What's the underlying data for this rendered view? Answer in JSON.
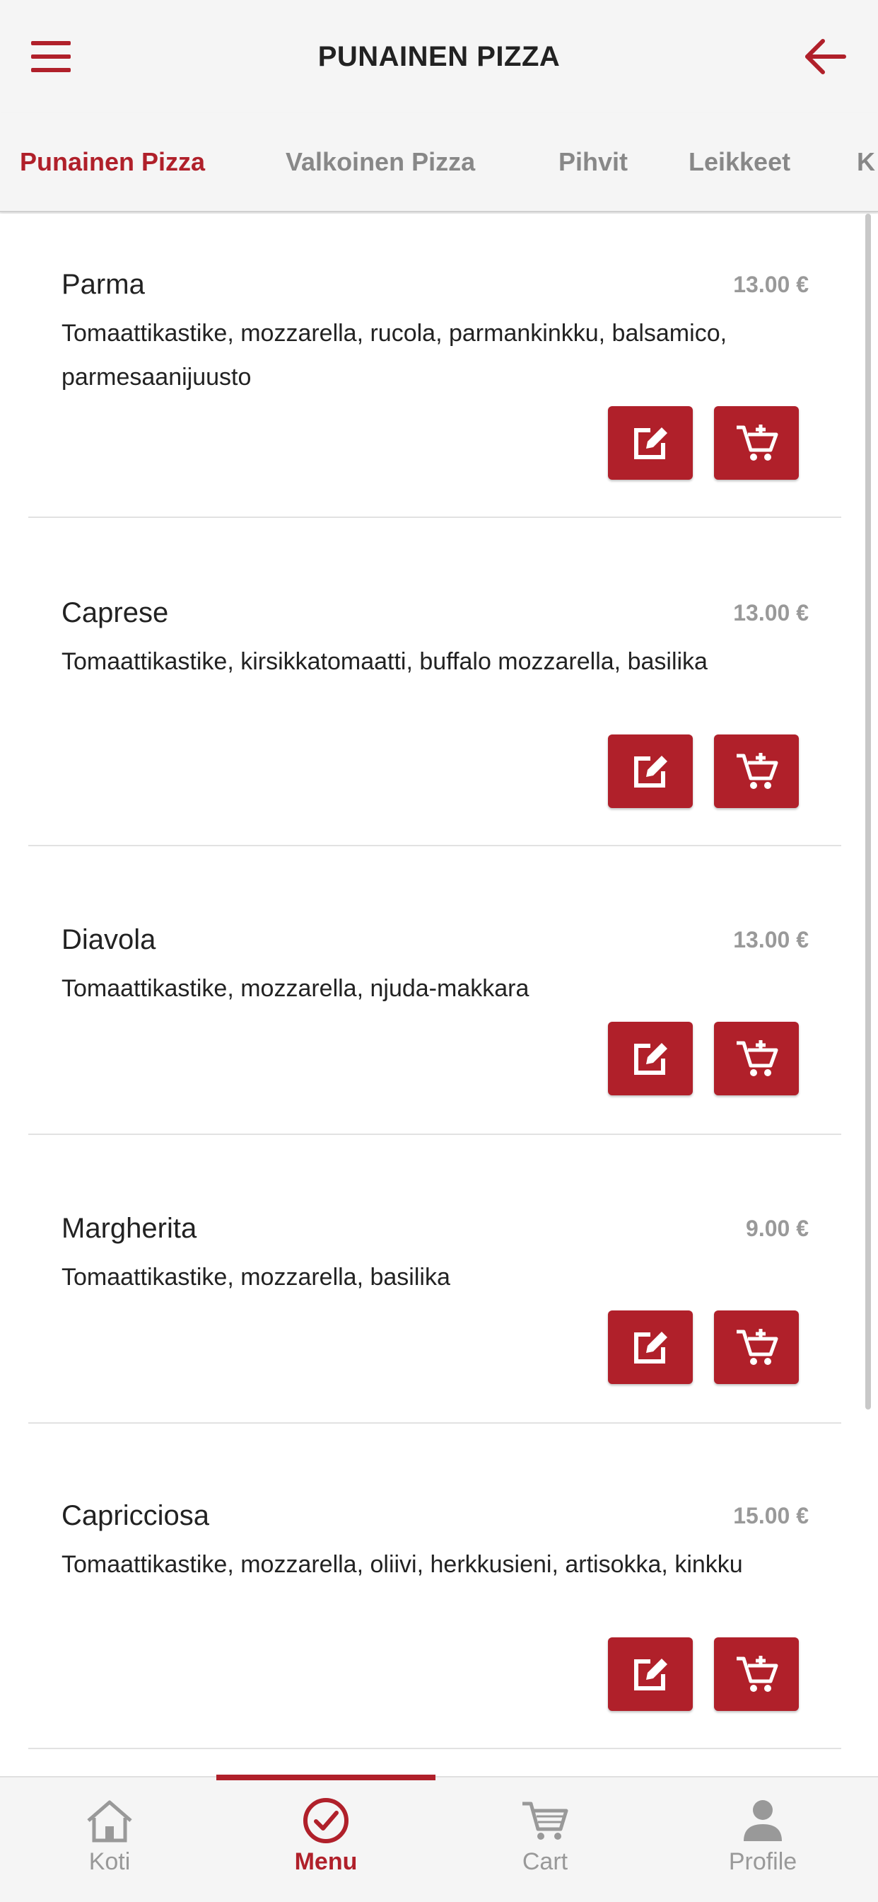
{
  "header": {
    "title": "PUNAINEN PIZZA"
  },
  "tabs": [
    {
      "label": "Punainen Pizza",
      "active": true
    },
    {
      "label": "Valkoinen Pizza",
      "active": false
    },
    {
      "label": "Pihvit",
      "active": false
    },
    {
      "label": "Leikkeet",
      "active": false
    },
    {
      "label": "K",
      "active": false
    }
  ],
  "items": [
    {
      "name": "Parma",
      "price": "13.00 €",
      "description": "Tomaattikastike, mozzarella, rucola, parmankinkku, balsamico, parmesaanijuusto"
    },
    {
      "name": "Caprese",
      "price": "13.00 €",
      "description": "Tomaattikastike, kirsikkatomaatti, buffalo mozzarella, basilika"
    },
    {
      "name": "Diavola",
      "price": "13.00 €",
      "description": "Tomaattikastike, mozzarella, njuda-makkara"
    },
    {
      "name": "Margherita",
      "price": "9.00 €",
      "description": "Tomaattikastike, mozzarella, basilika"
    },
    {
      "name": "Capricciosa",
      "price": "15.00 €",
      "description": "Tomaattikastike, mozzarella, oliivi, herkkusieni, artisokka, kinkku"
    }
  ],
  "bottom_nav": [
    {
      "label": "Koti",
      "icon": "home-icon",
      "active": false
    },
    {
      "label": "Menu",
      "icon": "check-circle-icon",
      "active": true
    },
    {
      "label": "Cart",
      "icon": "cart-icon",
      "active": false
    },
    {
      "label": "Profile",
      "icon": "person-icon",
      "active": false
    }
  ],
  "colors": {
    "accent": "#b0202a",
    "muted": "#999999"
  }
}
